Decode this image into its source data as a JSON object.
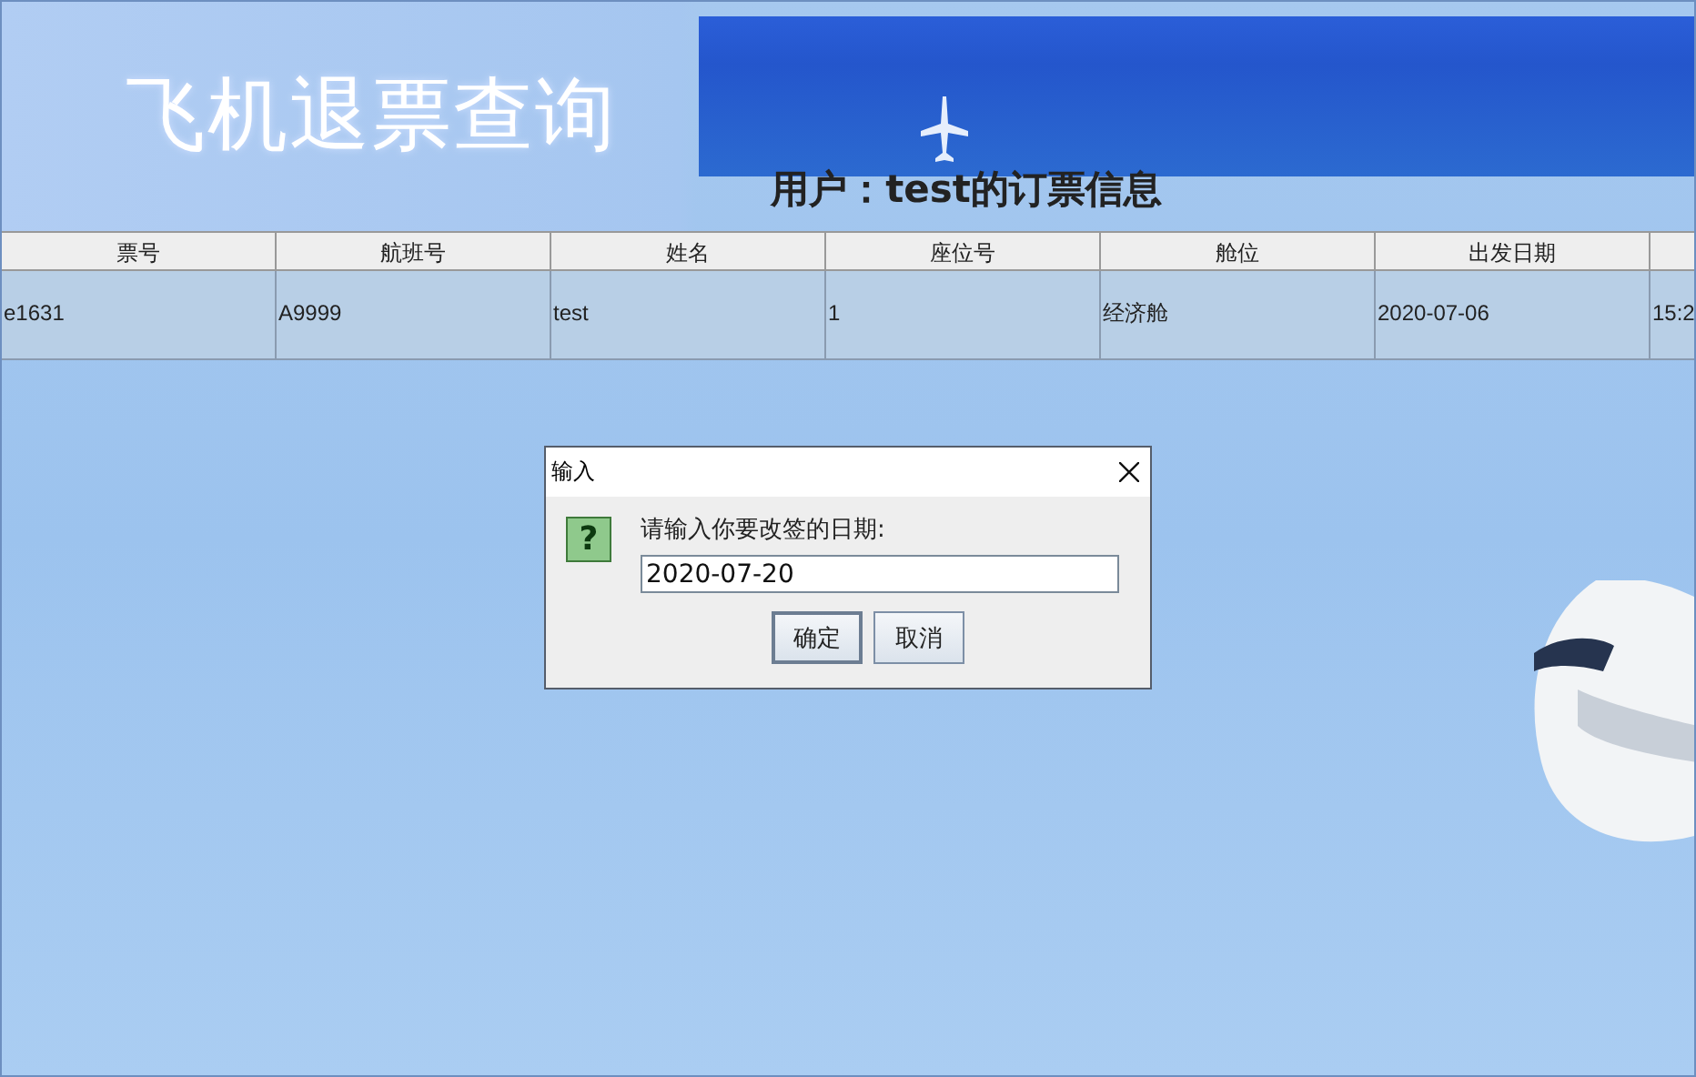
{
  "banner": {
    "title": "飞机退票查询",
    "subtitle": "用户：test的订票信息"
  },
  "table": {
    "columns": [
      "票号",
      "航班号",
      "姓名",
      "座位号",
      "舱位",
      "出发日期"
    ],
    "rows": [
      {
        "cells": [
          "e1631",
          "A9999",
          "test",
          "1",
          "经济舱",
          "2020-07-06",
          "15:2"
        ]
      }
    ]
  },
  "dialog": {
    "title": "输入",
    "icon": "?",
    "message": "请输入你要改签的日期:",
    "value": "2020-07-20",
    "buttons": [
      {
        "label": "确定",
        "focused": true
      },
      {
        "label": "取消",
        "focused": false
      }
    ]
  }
}
